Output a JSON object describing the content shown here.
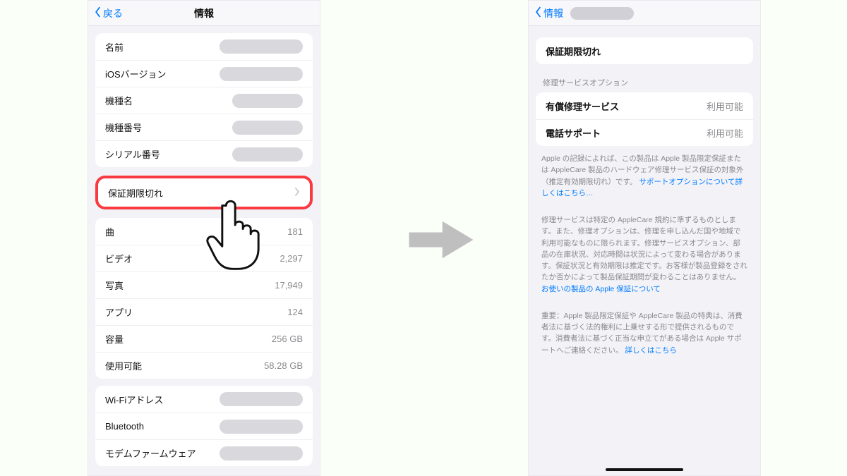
{
  "left": {
    "back": "戻る",
    "title": "情報",
    "device": {
      "name_label": "名前",
      "ios_label": "iOSバージョン",
      "model_name_label": "機種名",
      "model_number_label": "機種番号",
      "serial_label": "シリアル番号"
    },
    "coverage": {
      "label": "保証期限切れ"
    },
    "stats": [
      {
        "label": "曲",
        "value": "181"
      },
      {
        "label": "ビデオ",
        "value": "2,297"
      },
      {
        "label": "写真",
        "value": "17,949"
      },
      {
        "label": "アプリ",
        "value": "124"
      },
      {
        "label": "容量",
        "value": "256 GB"
      },
      {
        "label": "使用可能",
        "value": "58.28 GB"
      }
    ],
    "network": {
      "wifi_label": "Wi-Fiアドレス",
      "bt_label": "Bluetooth",
      "modem_label": "モデムファームウェア"
    }
  },
  "right": {
    "back": "情報",
    "status_row": "保証期限切れ",
    "service_header": "修理サービスオプション",
    "rows": [
      {
        "label": "有償修理サービス",
        "value": "利用可能"
      },
      {
        "label": "電話サポート",
        "value": "利用可能"
      }
    ],
    "p1_a": "Apple の記録によれば、この製品は Apple 製品限定保証または AppleCare 製品のハードウェア修理サービス保証の対象外（推定有効期限切れ）です。",
    "p1_link": "サポートオプションについて詳しくはこちら…",
    "p2_a": "修理サービスは特定の AppleCare 規約に準ずるものとします。また、修理オプションは、修理を申し込んだ国や地域で利用可能なものに限られます。修理サービスオプション、部品の在庫状況、対応時間は状況によって変わる場合があります。保証状況と有効期限は推定です。お客様が製品登録をされたか否かによって製品保証期間が変わることはありません。",
    "p2_link": "お使いの製品の Apple 保証について",
    "p3_a": "重要：Apple 製品限定保証や AppleCare 製品の特典は、消費者法に基づく法的権利に上乗せする形で提供されるものです。消費者法に基づく正当な申立てがある場合は Apple サポートへご連絡ください。",
    "p3_link": "詳しくはこちら"
  }
}
